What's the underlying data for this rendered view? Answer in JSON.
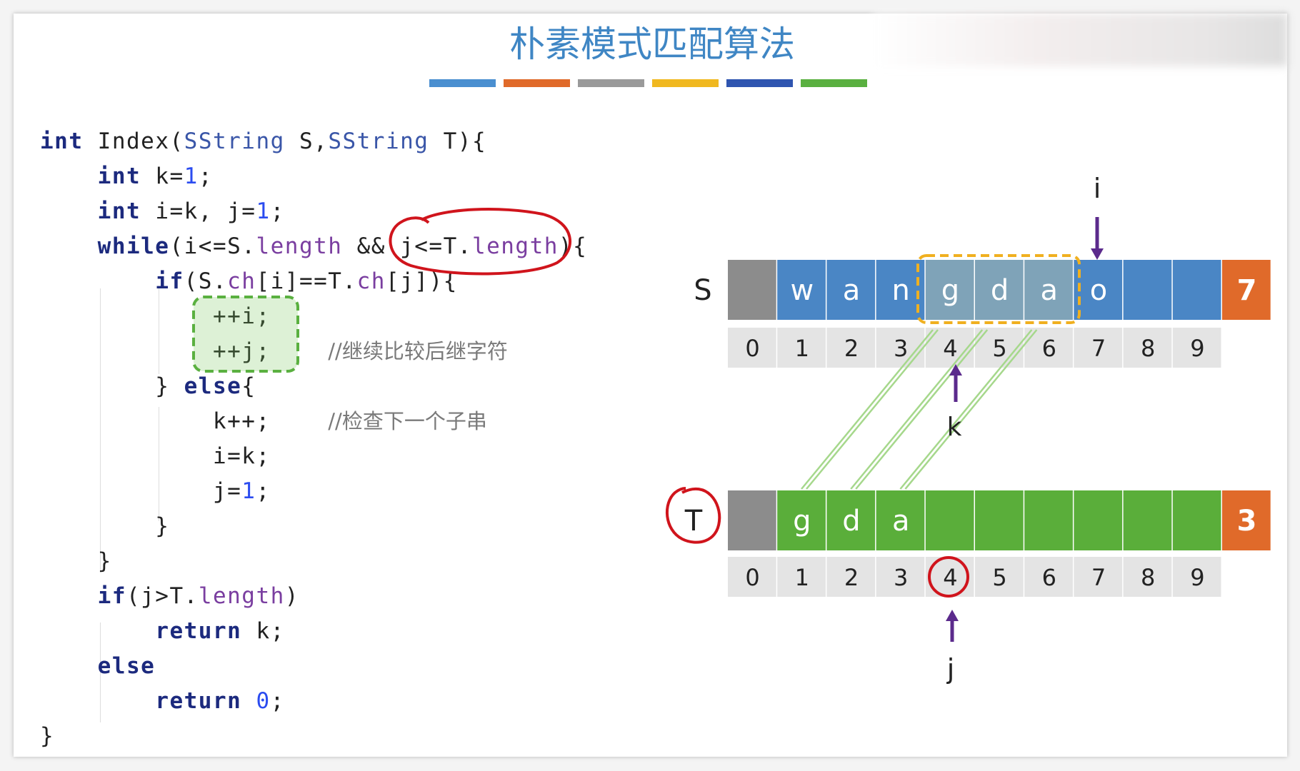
{
  "title": "朴素模式匹配算法",
  "title_bar_colors": [
    "#4a8fd0",
    "#e06a2a",
    "#9a9a9a",
    "#f0b820",
    "#2f55b0",
    "#5ab040"
  ],
  "code": [
    [
      {
        "t": "int",
        "c": "kw"
      },
      {
        "t": " Index("
      },
      {
        "t": "SString",
        "c": "ty"
      },
      {
        "t": " S,"
      },
      {
        "t": "SString",
        "c": "ty"
      },
      {
        "t": " T){"
      }
    ],
    [
      {
        "t": "    "
      },
      {
        "t": "int",
        "c": "kw"
      },
      {
        "t": " k="
      },
      {
        "t": "1",
        "c": "nm"
      },
      {
        "t": ";"
      }
    ],
    [
      {
        "t": "    "
      },
      {
        "t": "int",
        "c": "kw"
      },
      {
        "t": " i=k, j="
      },
      {
        "t": "1",
        "c": "nm"
      },
      {
        "t": ";"
      }
    ],
    [
      {
        "t": "    "
      },
      {
        "t": "while",
        "c": "kw"
      },
      {
        "t": "(i<=S."
      },
      {
        "t": "length",
        "c": "mb"
      },
      {
        "t": " && j<=T."
      },
      {
        "t": "length",
        "c": "mb"
      },
      {
        "t": "){"
      }
    ],
    [
      {
        "t": "        "
      },
      {
        "t": "if",
        "c": "kw"
      },
      {
        "t": "(S."
      },
      {
        "t": "ch",
        "c": "mb"
      },
      {
        "t": "[i]==T."
      },
      {
        "t": "ch",
        "c": "mb"
      },
      {
        "t": "[j]){"
      }
    ],
    [
      {
        "t": "            ++i;"
      }
    ],
    [
      {
        "t": "            ++j;    "
      },
      {
        "t": "//继续比较后继字符",
        "c": "cm"
      }
    ],
    [
      {
        "t": "        } "
      },
      {
        "t": "else",
        "c": "kw"
      },
      {
        "t": "{"
      }
    ],
    [
      {
        "t": "            k++;    "
      },
      {
        "t": "//检查下一个子串",
        "c": "cm"
      }
    ],
    [
      {
        "t": "            i=k;"
      }
    ],
    [
      {
        "t": "            j="
      },
      {
        "t": "1",
        "c": "nm"
      },
      {
        "t": ";"
      }
    ],
    [
      {
        "t": "        }"
      }
    ],
    [
      {
        "t": "    }"
      }
    ],
    [
      {
        "t": "    "
      },
      {
        "t": "if",
        "c": "kw"
      },
      {
        "t": "(j>T."
      },
      {
        "t": "length",
        "c": "mb"
      },
      {
        "t": ")"
      }
    ],
    [
      {
        "t": "        "
      },
      {
        "t": "return",
        "c": "kw"
      },
      {
        "t": " k;"
      }
    ],
    [
      {
        "t": "    "
      },
      {
        "t": "else",
        "c": "kw"
      }
    ],
    [
      {
        "t": "        "
      },
      {
        "t": "return",
        "c": "kw"
      },
      {
        "t": " "
      },
      {
        "t": "0",
        "c": "nm"
      },
      {
        "t": ";"
      }
    ],
    [
      {
        "t": "}"
      }
    ]
  ],
  "diagram": {
    "S": {
      "label": "S",
      "cells": [
        "",
        "w",
        "a",
        "n",
        "g",
        "d",
        "a",
        "o",
        "",
        "",
        ""
      ],
      "length": "7",
      "highlight": [
        4,
        5,
        6
      ]
    },
    "T": {
      "label": "T",
      "cells": [
        "",
        "g",
        "d",
        "a",
        "",
        "",
        "",
        "",
        "",
        "",
        ""
      ],
      "length": "3"
    },
    "indices": [
      "0",
      "1",
      "2",
      "3",
      "4",
      "5",
      "6",
      "7",
      "8",
      "9"
    ],
    "pointers": {
      "i": "i",
      "k": "k",
      "j": "j"
    },
    "pointer_positions": {
      "i": 7,
      "k": 4,
      "j": 4
    },
    "colors": {
      "S_cell": "#4a86c5",
      "T_cell": "#5aae3a",
      "head_cell": "#8c8c8c",
      "length_cell": "#e06a2a",
      "highlight_cell": "#7fa3b8",
      "index_bg": "#e4e4e4",
      "arrow": "#5b2a8c",
      "annotation": "#d0141c",
      "match_box": "#f0b020",
      "line": "#a6d88c"
    }
  }
}
